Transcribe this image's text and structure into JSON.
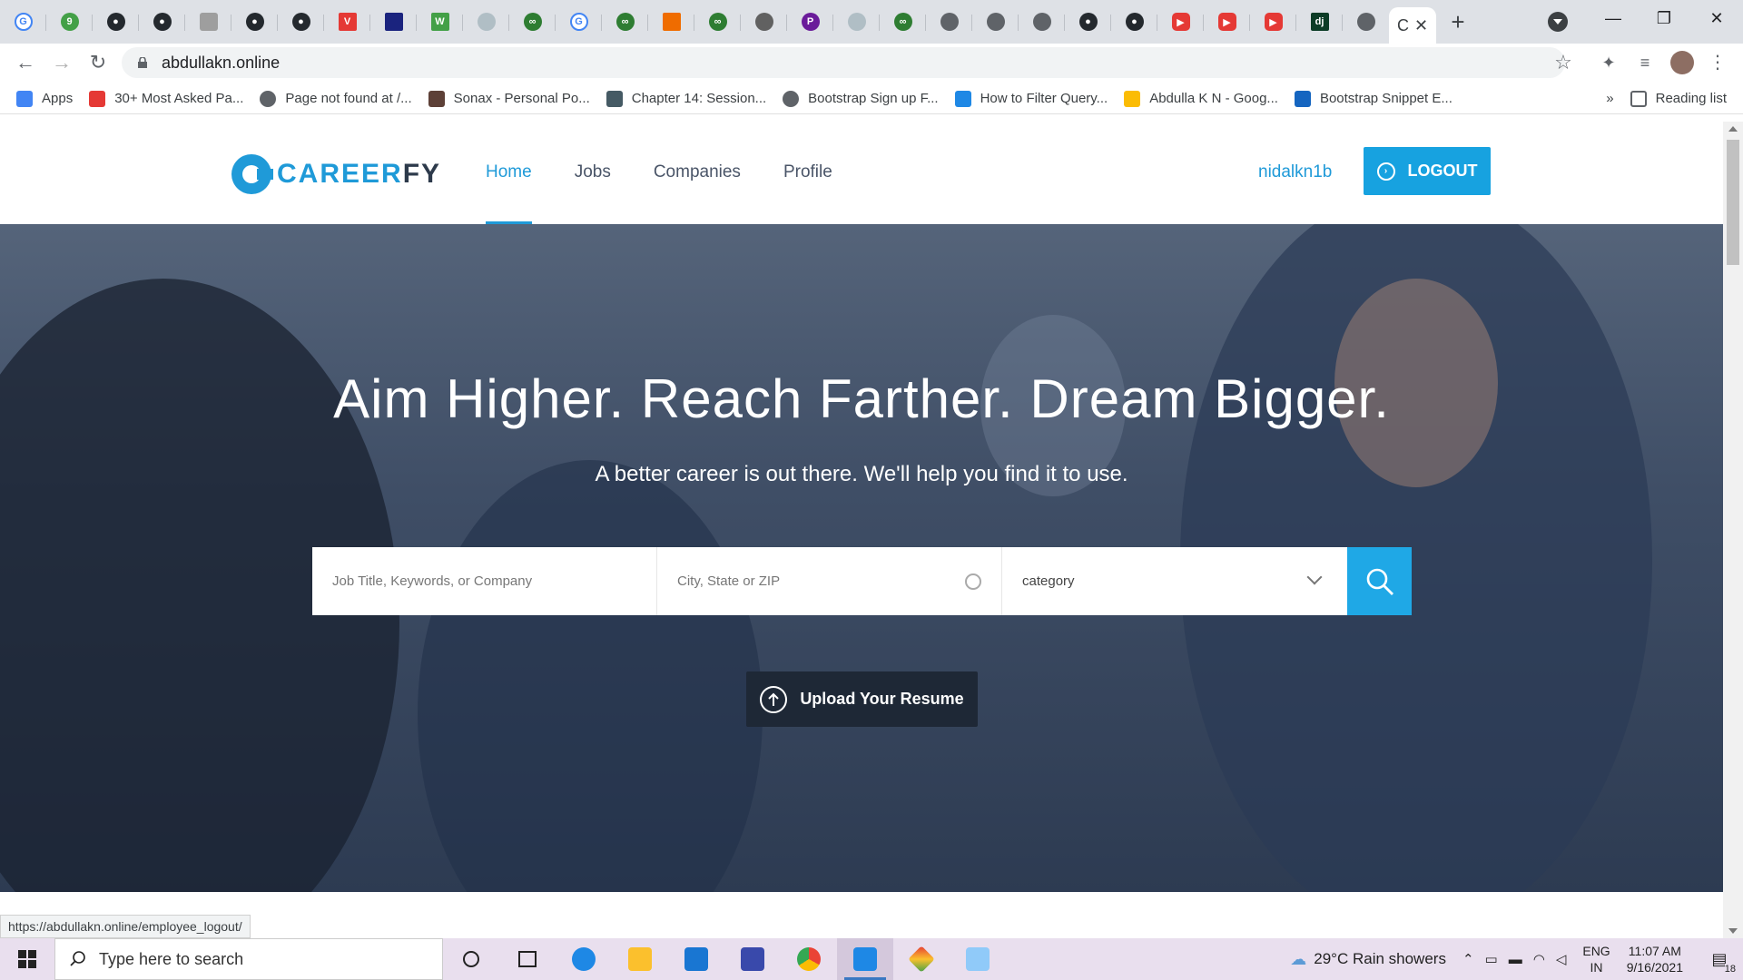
{
  "browser": {
    "address": "abdullakn.online",
    "active_tab_label": "C",
    "bookmarks": [
      {
        "label": "Apps",
        "color": "#4285f4"
      },
      {
        "label": "30+ Most Asked Pa...",
        "color": "#e53935"
      },
      {
        "label": "Page not found at /...",
        "color": "#5f6368"
      },
      {
        "label": "Sonax - Personal Po...",
        "color": "#5d4037"
      },
      {
        "label": "Chapter 14: Session...",
        "color": "#455a64"
      },
      {
        "label": "Bootstrap Sign up F...",
        "color": "#5f6368"
      },
      {
        "label": "How to Filter Query...",
        "color": "#1e88e5"
      },
      {
        "label": "Abdulla K N - Goog...",
        "color": "#fbbc04"
      },
      {
        "label": "Bootstrap Snippet E...",
        "color": "#1565c0"
      }
    ],
    "bookmarks_overflow": "»",
    "reading_list": "Reading list",
    "status_url": "https://abdullakn.online/employee_logout/"
  },
  "site": {
    "logo_main": "CAREER",
    "logo_accent": "FY",
    "nav": [
      "Home",
      "Jobs",
      "Companies",
      "Profile"
    ],
    "username": "nidalkn1b",
    "logout_label": "LOGOUT",
    "hero_title": "Aim Higher. Reach Farther. Dream Bigger.",
    "hero_subtitle": "A better career is out there. We'll help you find it to use.",
    "search": {
      "keyword_placeholder": "Job Title, Keywords, or Company",
      "location_placeholder": "City, State or ZIP",
      "category_value": "category"
    },
    "upload_label": "Upload Your Resume",
    "accent_color": "#1fa8e6"
  },
  "taskbar": {
    "search_placeholder": "Type here to search",
    "weather": "29°C  Rain showers",
    "lang_top": "ENG",
    "lang_bottom": "IN",
    "time": "11:07 AM",
    "date": "9/16/2021",
    "notifications": "18"
  }
}
